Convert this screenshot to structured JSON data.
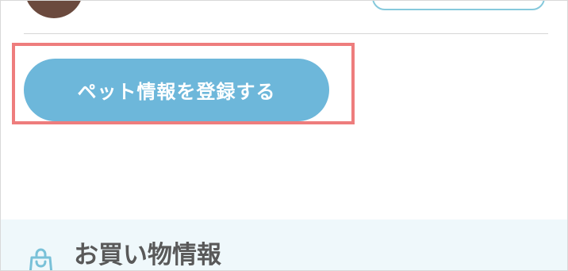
{
  "profile": {
    "avatar_icon": "user-avatar-icon",
    "top_button_label": ""
  },
  "actions": {
    "register_pet_label": "ペット情報を登録する"
  },
  "shopping": {
    "title": "お買い物情報",
    "icon": "shopping-bag-icon"
  },
  "colors": {
    "avatar": "#6b4a3e",
    "outline_button": "#86c9dc",
    "primary_button": "#6db7da",
    "highlight": "#ee7d7d",
    "section_band": "#eff8fb",
    "section_title": "#595959"
  }
}
